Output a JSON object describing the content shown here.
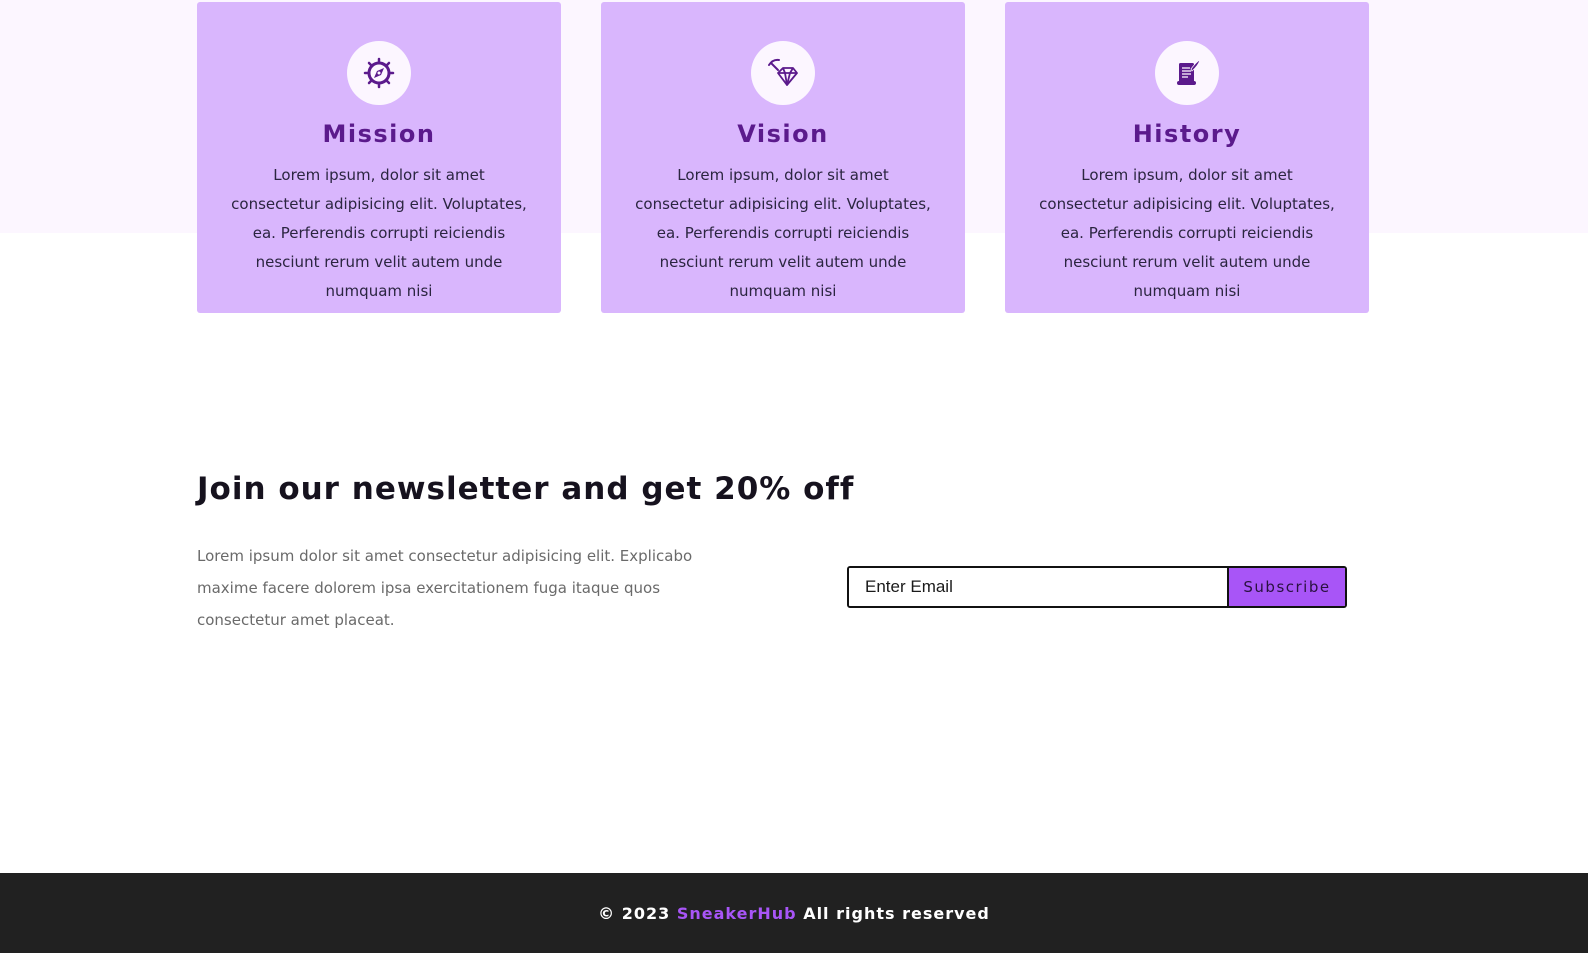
{
  "cards": [
    {
      "icon": "compass-icon",
      "title": "Mission",
      "text": "Lorem ipsum, dolor sit amet consectetur adipisicing elit. Voluptates, ea. Perferendis corrupti reiciendis nesciunt rerum velit autem unde numquam nisi"
    },
    {
      "icon": "diamond-pickaxe-icon",
      "title": "Vision",
      "text": "Lorem ipsum, dolor sit amet consectetur adipisicing elit. Voluptates, ea. Perferendis corrupti reiciendis nesciunt rerum velit autem unde numquam nisi"
    },
    {
      "icon": "scroll-quill-icon",
      "title": "History",
      "text": "Lorem ipsum, dolor sit amet consectetur adipisicing elit. Voluptates, ea. Perferendis corrupti reiciendis nesciunt rerum velit autem unde numquam nisi"
    }
  ],
  "newsletter": {
    "title": "Join our newsletter and get 20% off",
    "body": "Lorem ipsum dolor sit amet consectetur adipisicing elit. Explicabo maxime facere dolorem ipsa exercitationem fuga itaque quos consectetur amet placeat.",
    "email_placeholder": "Enter Email",
    "subscribe_label": "Subscribe"
  },
  "footer": {
    "prefix": "© 2023",
    "brand": "SneakerHub",
    "suffix": "All rights reserved"
  },
  "colors": {
    "card_bg": "#d9b6fd",
    "card_title": "#5b1a8c",
    "accent": "#a855f7",
    "band_bg": "#fcf6ff",
    "footer_bg": "#212121"
  }
}
